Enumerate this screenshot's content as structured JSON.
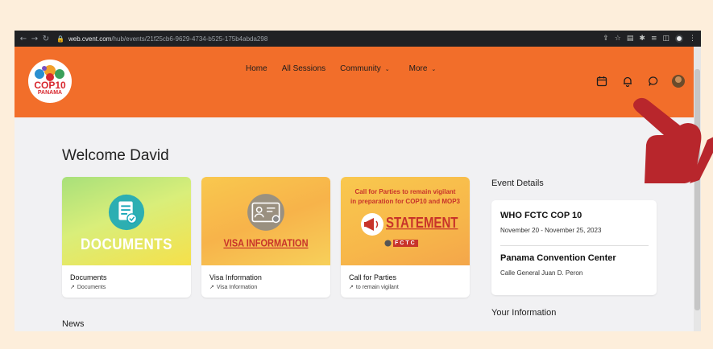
{
  "browser": {
    "url_domain": "web.cvent.com",
    "url_path": "/hub/events/21f25cb6-9629-4734-b525-175b4abda298"
  },
  "logo": {
    "text": "COP10",
    "subtext": "PANAMA"
  },
  "nav": [
    {
      "label": "Home",
      "has_menu": false
    },
    {
      "label": "All Sessions",
      "has_menu": false
    },
    {
      "label": "Community",
      "has_menu": true
    },
    {
      "label": "More",
      "has_menu": true
    }
  ],
  "header_icons": [
    "calendar-icon",
    "bell-icon",
    "chat-icon",
    "avatar"
  ],
  "welcome": "Welcome David",
  "cards": [
    {
      "image_text": "DOCUMENTS",
      "title": "Documents",
      "link": "Documents"
    },
    {
      "image_text": "VISA INFORMATION",
      "title": "Visa Information",
      "link": "Visa Information"
    },
    {
      "image_lines": [
        "Call for Parties to remain vigilant",
        "in preparation for COP10 and MOP3"
      ],
      "image_text": "STATEMENT",
      "image_badge": "FCTC",
      "title": "Call for Parties",
      "link": "to remain vigilant"
    }
  ],
  "news_heading": "News",
  "event": {
    "heading": "Event Details",
    "title": "WHO FCTC COP 10",
    "dates": "November 20 - November 25, 2023",
    "venue": "Panama Convention Center",
    "address": "Calle General Juan D. Peron"
  },
  "your_info_heading": "Your Information",
  "colors": {
    "header": "#f26e2a",
    "accent_red": "#c8332a",
    "page_bg": "#fdeedb",
    "content_bg": "#f1f1f3",
    "hand": "#b8262c"
  }
}
